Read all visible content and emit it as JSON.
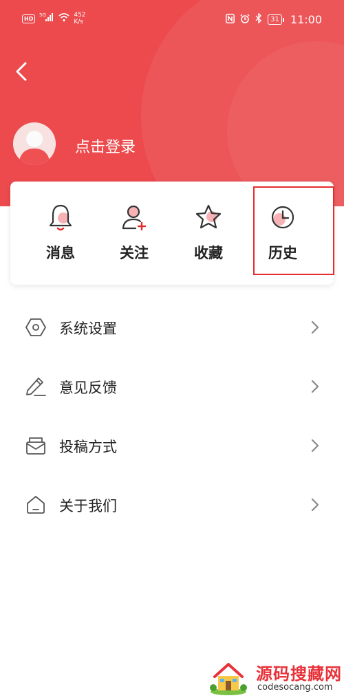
{
  "status_bar": {
    "hd_badge": "HD",
    "network": "5G",
    "speed_value": "452",
    "speed_unit": "K/s",
    "battery": "31",
    "time": "11:00"
  },
  "profile": {
    "login_text": "点击登录"
  },
  "quick_actions": [
    {
      "label": "消息",
      "icon": "bell-icon"
    },
    {
      "label": "关注",
      "icon": "user-add-icon"
    },
    {
      "label": "收藏",
      "icon": "star-icon"
    },
    {
      "label": "历史",
      "icon": "clock-icon"
    }
  ],
  "menu": [
    {
      "label": "系统设置",
      "icon": "settings-hexagon-icon"
    },
    {
      "label": "意见反馈",
      "icon": "pencil-icon"
    },
    {
      "label": "投稿方式",
      "icon": "mail-icon"
    },
    {
      "label": "关于我们",
      "icon": "home-icon"
    }
  ],
  "watermark": {
    "title": "源码搜藏网",
    "url": "codesocang.com"
  },
  "colors": {
    "accent": "#ec4a4d",
    "highlight_box": "#e52b2b",
    "text": "#222222",
    "icon_gray": "#555555"
  }
}
